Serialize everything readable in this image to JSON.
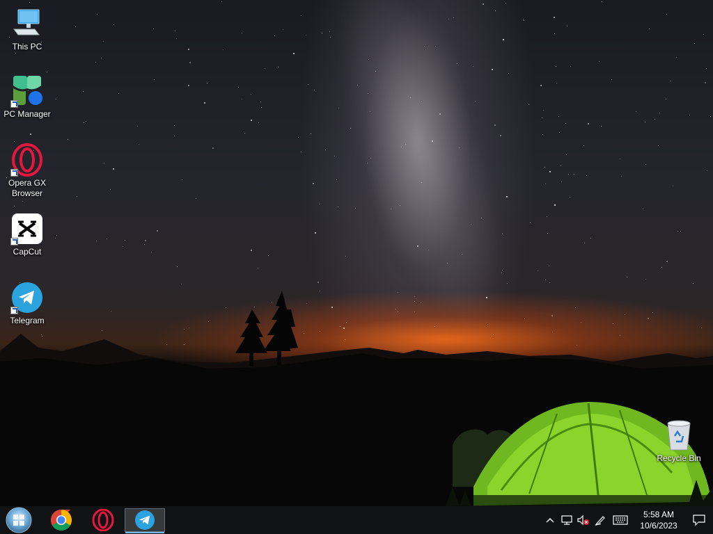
{
  "desktop": {
    "icons": [
      {
        "label": "This PC",
        "icon": "computer-icon"
      },
      {
        "label": "PC Manager",
        "icon": "pc-manager-icon"
      },
      {
        "label": "Opera GX Browser",
        "icon": "opera-gx-icon"
      },
      {
        "label": "CapCut",
        "icon": "capcut-icon"
      },
      {
        "label": "Telegram",
        "icon": "telegram-icon"
      },
      {
        "label": "Recycle Bin",
        "icon": "recycle-bin-icon"
      }
    ]
  },
  "taskbar": {
    "pinned": [
      {
        "icon": "windows-start-icon",
        "active": false
      },
      {
        "icon": "chrome-icon",
        "active": false
      },
      {
        "icon": "opera-icon",
        "active": false
      },
      {
        "icon": "telegram-icon",
        "active": true
      }
    ],
    "tray": {
      "icons": [
        "chevron-up-icon",
        "network-icon",
        "volume-muted-icon",
        "pen-icon",
        "keyboard-icon",
        "notification-icon"
      ],
      "time": "5:58 AM",
      "date": "10/6/2023"
    }
  },
  "colors": {
    "taskbar_bg": "#111214",
    "accent": "#76b9ed",
    "tent_green": "#7ed321",
    "horizon_orange": "#ff6e19"
  }
}
